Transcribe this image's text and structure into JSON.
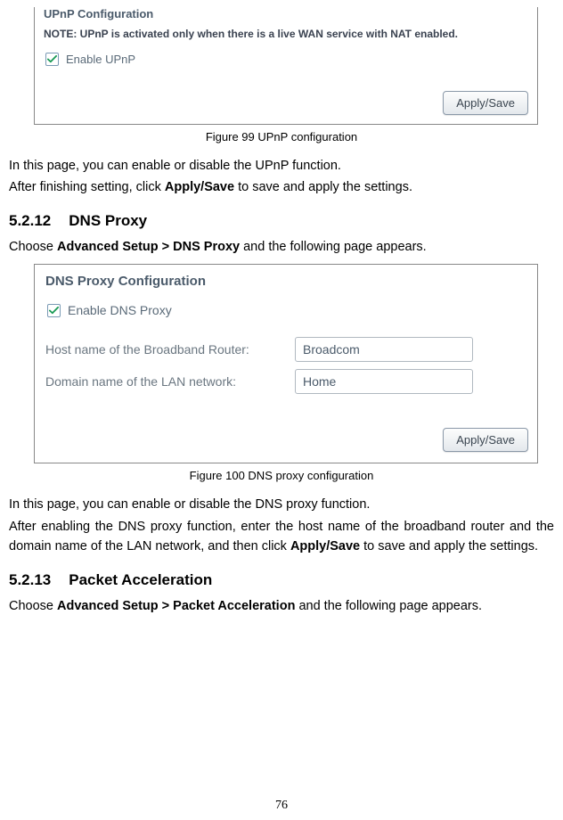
{
  "upnp": {
    "title": "UPnP Configuration",
    "note": "NOTE: UPnP is activated only when there is a live WAN service with NAT enabled.",
    "checkbox_label": "Enable UPnP",
    "apply_label": "Apply/Save"
  },
  "caption1": "Figure 99 UPnP configuration",
  "para1": "In this page, you can enable or disable the UPnP function.",
  "para2_pre": "After finishing setting, click ",
  "para2_bold": "Apply/Save",
  "para2_post": " to save and apply the settings.",
  "sec12": {
    "num": "5.2.12",
    "title": "DNS Proxy"
  },
  "sec12_intro_pre": "Choose ",
  "sec12_intro_bold": "Advanced Setup > DNS Proxy",
  "sec12_intro_post": " and the following page appears.",
  "dns": {
    "title": "DNS Proxy Configuration",
    "checkbox_label": "Enable DNS Proxy",
    "host_label": "Host name of the Broadband Router:",
    "host_value": "Broadcom",
    "domain_label": "Domain name of the LAN network:",
    "domain_value": "Home",
    "apply_label": "Apply/Save"
  },
  "caption2": "Figure 100 DNS proxy configuration",
  "para3": "In this page, you can enable or disable the DNS proxy function.",
  "para4_pre": "After enabling the DNS proxy function, enter the host name of the broadband router and the domain name of the LAN network, and then click ",
  "para4_bold": "Apply/Save",
  "para4_post": " to save and apply the settings.",
  "sec13": {
    "num": "5.2.13",
    "title": "Packet Acceleration"
  },
  "sec13_intro_pre": "Choose ",
  "sec13_intro_bold": "Advanced Setup > Packet Acceleration",
  "sec13_intro_post": " and the following page appears.",
  "page_number": "76"
}
